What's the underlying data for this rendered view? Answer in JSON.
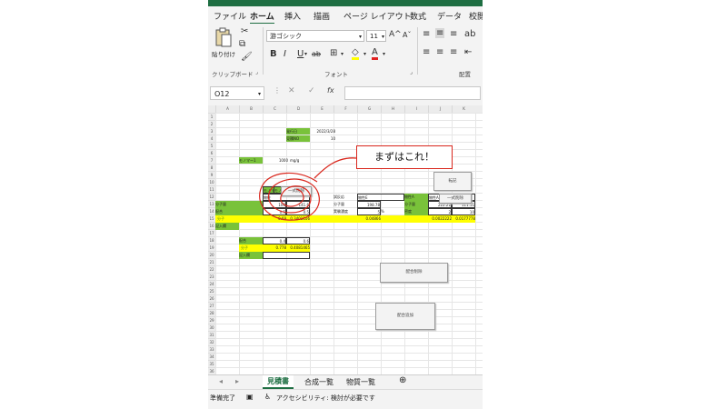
{
  "ribbon": {
    "tabs": [
      "ファイル",
      "ホーム",
      "挿入",
      "描画",
      "ページ レイアウト",
      "数式",
      "データ",
      "校閲"
    ],
    "active_tab": "ホーム",
    "paste_label": "貼り付け",
    "clipboard_group": "クリップボード",
    "font_group": "フォント",
    "align_group": "配置",
    "font_name": "游ゴシック",
    "font_size": "11",
    "grow_font": "A^",
    "shrink_font": "Aˇ",
    "bold": "B",
    "italic": "I",
    "underline": "U",
    "strike": "ab",
    "font_color_glyph": "A"
  },
  "formula_bar": {
    "name_box": "O12",
    "cancel": "✕",
    "enter": "✓",
    "fx": "fx"
  },
  "columns": [
    "A",
    "B",
    "C",
    "D",
    "E",
    "F",
    "G",
    "H",
    "I",
    "J",
    "K"
  ],
  "rows": [
    "1",
    "2",
    "3",
    "4",
    "5",
    "6",
    "7",
    "8",
    "9",
    "10",
    "11",
    "12",
    "13",
    "14",
    "15",
    "16",
    "17",
    "18",
    "19",
    "20",
    "21",
    "22",
    "23",
    "24",
    "25",
    "26",
    "27",
    "28",
    "29",
    "30",
    "31",
    "32",
    "33",
    "34",
    "35",
    "36"
  ],
  "sheet": {
    "date_label": "発行日",
    "date_value": "2022/3/28",
    "no_label": "見積NO",
    "no_value": "10",
    "target_label": "モノマー1",
    "target_value": "1000",
    "target_unit": "mg/g",
    "h_mono1": "モノマー1",
    "h_mono2": "モノマー2",
    "h_mono3": "モノマー3",
    "property": "物性",
    "physical_e": "物性E",
    "reaction": "試反応",
    "physical_a": "物性A",
    "physical_f": "物性F",
    "molecular_weight": "分子量",
    "mw1": "100",
    "mw2": "141.6",
    "mw_mid": "198.78",
    "mw3": "222.22",
    "mw4": "111.11",
    "ratio": "配合",
    "r1": "0.5",
    "r2": "0.5",
    "r3": "5",
    "r_unit": "%",
    "r4": "2",
    "r5": "10",
    "density_label": "実験濃度",
    "calc_label": "密度",
    "mol": "分子",
    "m1": "0.69",
    "m2": "0.3401106",
    "m3": "0.04866",
    "m4": "0.0022222",
    "m5": "0.0177778",
    "fill_label": "記入欄",
    "ratio2_label": "配合",
    "r2_1": "0.4",
    "r2_2": "0.6",
    "mol2_label": "分子",
    "m2_1": "0.778",
    "m2_2": "0.4081465",
    "fill2_label": "記入欄"
  },
  "buttons": {
    "top": "転記",
    "clear_all": "一式削除",
    "clear_right": "一式削除",
    "delete_ratio": "配合削除",
    "add_ratio": "配合追加"
  },
  "callout": "まずはこれ！",
  "sheet_tabs": [
    "見積書",
    "合成一覧",
    "物質一覧"
  ],
  "active_sheet": "見積書",
  "status": {
    "ready": "準備完了",
    "accessibility": "アクセシビリティ: 検討が必要です"
  }
}
